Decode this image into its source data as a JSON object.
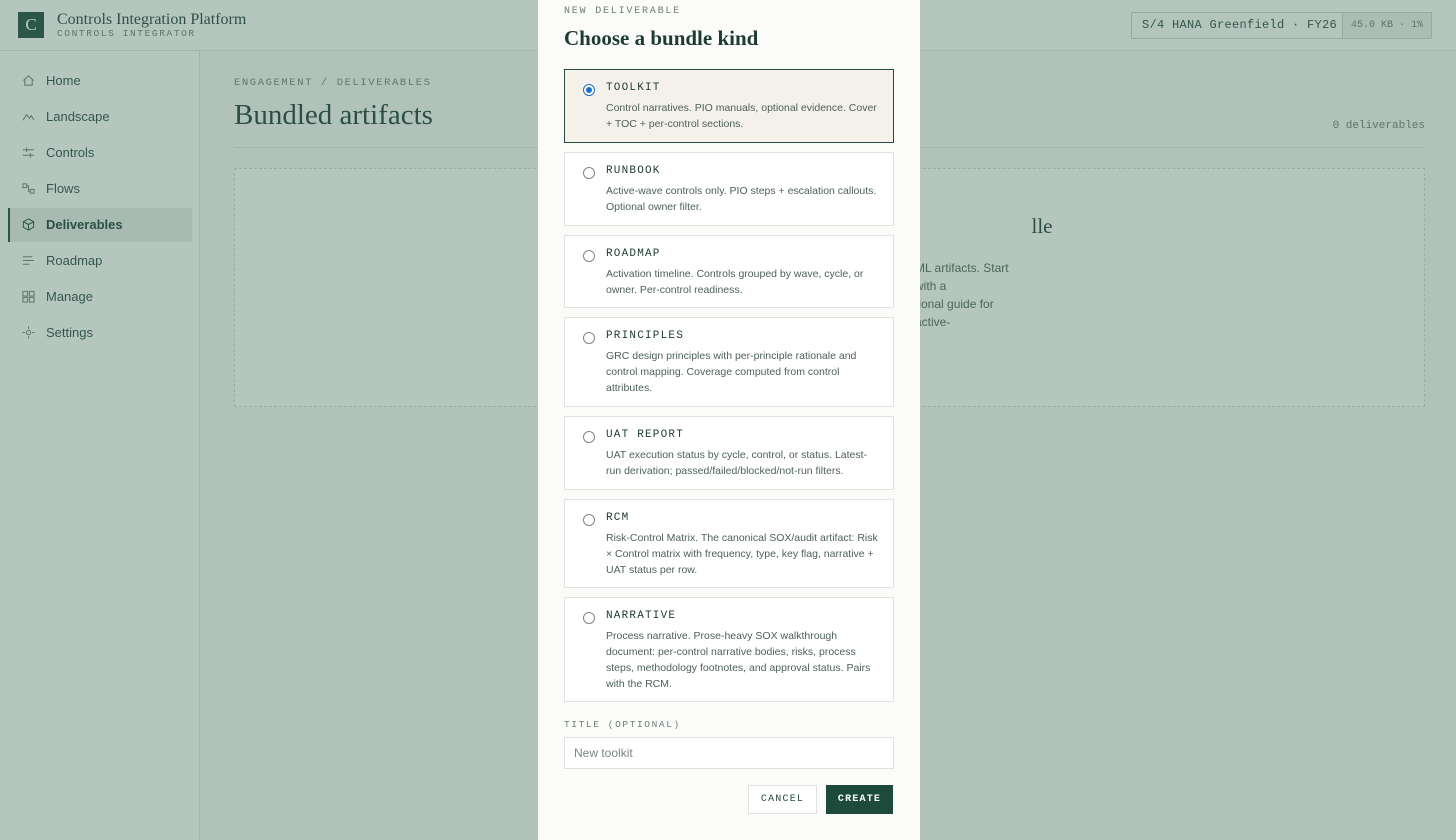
{
  "app": {
    "logo_letter": "C",
    "title": "Controls Integration Platform",
    "subtitle": "CONTROLS INTEGRATOR",
    "environment": "S/4 HANA Greenfield · FY26",
    "storage": "45.0 KB · 1%"
  },
  "sidebar": {
    "items": [
      {
        "label": "Home",
        "icon": "home-icon",
        "active": false
      },
      {
        "label": "Landscape",
        "icon": "landscape-icon",
        "active": false
      },
      {
        "label": "Controls",
        "icon": "sliders-icon",
        "active": false
      },
      {
        "label": "Flows",
        "icon": "flow-icon",
        "active": false
      },
      {
        "label": "Deliverables",
        "icon": "package-icon",
        "active": true
      },
      {
        "label": "Roadmap",
        "icon": "roadmap-icon",
        "active": false
      },
      {
        "label": "Manage",
        "icon": "grid-icon",
        "active": false
      },
      {
        "label": "Settings",
        "icon": "settings-icon",
        "active": false
      }
    ]
  },
  "page": {
    "breadcrumb": "ENGAGEMENT / DELIVERABLES",
    "title": "Bundled artifacts",
    "count": "0 deliverables",
    "empty_title": "lle",
    "empty_body_1": "ML artifacts. Start with a",
    "empty_body_2": "tional guide for active-"
  },
  "modal": {
    "eyebrow": "NEW DELIVERABLE",
    "title": "Choose a bundle kind",
    "options": [
      {
        "name": "TOOLKIT",
        "desc": "Control narratives. PIO manuals, optional evidence. Cover + TOC + per-control sections.",
        "selected": true
      },
      {
        "name": "RUNBOOK",
        "desc": "Active-wave controls only. PIO steps + escalation callouts. Optional owner filter.",
        "selected": false
      },
      {
        "name": "ROADMAP",
        "desc": "Activation timeline. Controls grouped by wave, cycle, or owner. Per-control readiness.",
        "selected": false
      },
      {
        "name": "PRINCIPLES",
        "desc": "GRC design principles with per-principle rationale and control mapping. Coverage computed from control attributes.",
        "selected": false
      },
      {
        "name": "UAT REPORT",
        "desc": "UAT execution status by cycle, control, or status. Latest-run derivation; passed/failed/blocked/not-run filters.",
        "selected": false
      },
      {
        "name": "RCM",
        "desc": "Risk-Control Matrix. The canonical SOX/audit artifact: Risk × Control matrix with frequency, type, key flag, narrative + UAT status per row.",
        "selected": false
      },
      {
        "name": "NARRATIVE",
        "desc": "Process narrative. Prose-heavy SOX walkthrough document: per-control narrative bodies, risks, process steps, methodology footnotes, and approval status. Pairs with the RCM.",
        "selected": false
      }
    ],
    "title_label": "TITLE (OPTIONAL)",
    "title_placeholder": "New toolkit",
    "cancel_label": "CANCEL",
    "create_label": "CREATE"
  }
}
